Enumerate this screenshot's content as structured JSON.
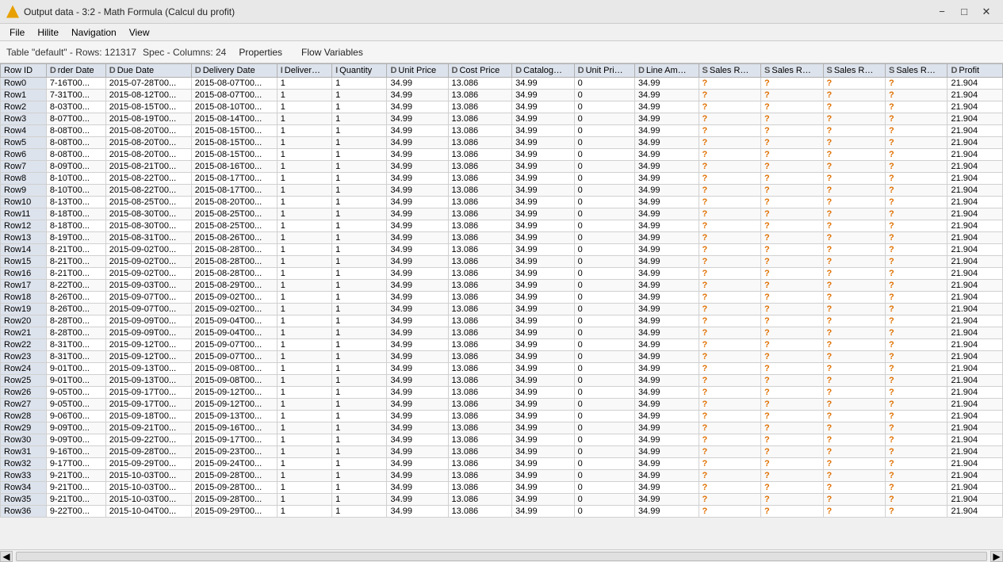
{
  "titleBar": {
    "icon": "triangle-warning",
    "title": "Output data - 3:2 - Math Formula (Calcul du profit)",
    "minimizeLabel": "−",
    "maximizeLabel": "□",
    "closeLabel": "✕"
  },
  "menuBar": {
    "items": [
      "File",
      "Hilite",
      "Navigation",
      "View"
    ]
  },
  "toolbar": {
    "tableInfo": "Table \"default\" - Rows: 121317",
    "specInfo": "Spec - Columns: 24",
    "tabs": [
      {
        "label": "Properties",
        "active": false
      },
      {
        "label": "Flow Variables",
        "active": false
      }
    ]
  },
  "columns": [
    {
      "typeCode": "",
      "label": "Row ID"
    },
    {
      "typeCode": "D",
      "label": "rder Date"
    },
    {
      "typeCode": "D",
      "label": "Due Date"
    },
    {
      "typeCode": "D",
      "label": "Delivery Date"
    },
    {
      "typeCode": "I",
      "label": "Deliver…"
    },
    {
      "typeCode": "I",
      "label": "Quantity"
    },
    {
      "typeCode": "D",
      "label": "Unit Price"
    },
    {
      "typeCode": "D",
      "label": "Cost Price"
    },
    {
      "typeCode": "D",
      "label": "Catalog…"
    },
    {
      "typeCode": "D",
      "label": "Unit Pri…"
    },
    {
      "typeCode": "D",
      "label": "Line Am…"
    },
    {
      "typeCode": "S",
      "label": "Sales R…"
    },
    {
      "typeCode": "S",
      "label": "Sales R…"
    },
    {
      "typeCode": "S",
      "label": "Sales R…"
    },
    {
      "typeCode": "S",
      "label": "Sales R…"
    },
    {
      "typeCode": "D",
      "label": "Profit"
    }
  ],
  "rows": [
    {
      "id": "Row0",
      "orderDate": "7-16T00...",
      "dueDate": "2015-07-28T00...",
      "deliveryDate": "2015-08-07T00...",
      "deliver": "1",
      "quantity": "1",
      "unitPrice": "34.99",
      "costPrice": "13.086",
      "catalog": "34.99",
      "unitPri": "0",
      "lineAm": "34.99",
      "sr1": "?",
      "sr2": "?",
      "sr3": "?",
      "sr4": "?",
      "profit": "21.904"
    },
    {
      "id": "Row1",
      "orderDate": "7-31T00...",
      "dueDate": "2015-08-12T00...",
      "deliveryDate": "2015-08-07T00...",
      "deliver": "1",
      "quantity": "1",
      "unitPrice": "34.99",
      "costPrice": "13.086",
      "catalog": "34.99",
      "unitPri": "0",
      "lineAm": "34.99",
      "sr1": "?",
      "sr2": "?",
      "sr3": "?",
      "sr4": "?",
      "profit": "21.904"
    },
    {
      "id": "Row2",
      "orderDate": "8-03T00...",
      "dueDate": "2015-08-15T00...",
      "deliveryDate": "2015-08-10T00...",
      "deliver": "1",
      "quantity": "1",
      "unitPrice": "34.99",
      "costPrice": "13.086",
      "catalog": "34.99",
      "unitPri": "0",
      "lineAm": "34.99",
      "sr1": "?",
      "sr2": "?",
      "sr3": "?",
      "sr4": "?",
      "profit": "21.904"
    },
    {
      "id": "Row3",
      "orderDate": "8-07T00...",
      "dueDate": "2015-08-19T00...",
      "deliveryDate": "2015-08-14T00...",
      "deliver": "1",
      "quantity": "1",
      "unitPrice": "34.99",
      "costPrice": "13.086",
      "catalog": "34.99",
      "unitPri": "0",
      "lineAm": "34.99",
      "sr1": "?",
      "sr2": "?",
      "sr3": "?",
      "sr4": "?",
      "profit": "21.904"
    },
    {
      "id": "Row4",
      "orderDate": "8-08T00...",
      "dueDate": "2015-08-20T00...",
      "deliveryDate": "2015-08-15T00...",
      "deliver": "1",
      "quantity": "1",
      "unitPrice": "34.99",
      "costPrice": "13.086",
      "catalog": "34.99",
      "unitPri": "0",
      "lineAm": "34.99",
      "sr1": "?",
      "sr2": "?",
      "sr3": "?",
      "sr4": "?",
      "profit": "21.904"
    },
    {
      "id": "Row5",
      "orderDate": "8-08T00...",
      "dueDate": "2015-08-20T00...",
      "deliveryDate": "2015-08-15T00...",
      "deliver": "1",
      "quantity": "1",
      "unitPrice": "34.99",
      "costPrice": "13.086",
      "catalog": "34.99",
      "unitPri": "0",
      "lineAm": "34.99",
      "sr1": "?",
      "sr2": "?",
      "sr3": "?",
      "sr4": "?",
      "profit": "21.904"
    },
    {
      "id": "Row6",
      "orderDate": "8-08T00...",
      "dueDate": "2015-08-20T00...",
      "deliveryDate": "2015-08-15T00...",
      "deliver": "1",
      "quantity": "1",
      "unitPrice": "34.99",
      "costPrice": "13.086",
      "catalog": "34.99",
      "unitPri": "0",
      "lineAm": "34.99",
      "sr1": "?",
      "sr2": "?",
      "sr3": "?",
      "sr4": "?",
      "profit": "21.904"
    },
    {
      "id": "Row7",
      "orderDate": "8-09T00...",
      "dueDate": "2015-08-21T00...",
      "deliveryDate": "2015-08-16T00...",
      "deliver": "1",
      "quantity": "1",
      "unitPrice": "34.99",
      "costPrice": "13.086",
      "catalog": "34.99",
      "unitPri": "0",
      "lineAm": "34.99",
      "sr1": "?",
      "sr2": "?",
      "sr3": "?",
      "sr4": "?",
      "profit": "21.904"
    },
    {
      "id": "Row8",
      "orderDate": "8-10T00...",
      "dueDate": "2015-08-22T00...",
      "deliveryDate": "2015-08-17T00...",
      "deliver": "1",
      "quantity": "1",
      "unitPrice": "34.99",
      "costPrice": "13.086",
      "catalog": "34.99",
      "unitPri": "0",
      "lineAm": "34.99",
      "sr1": "?",
      "sr2": "?",
      "sr3": "?",
      "sr4": "?",
      "profit": "21.904"
    },
    {
      "id": "Row9",
      "orderDate": "8-10T00...",
      "dueDate": "2015-08-22T00...",
      "deliveryDate": "2015-08-17T00...",
      "deliver": "1",
      "quantity": "1",
      "unitPrice": "34.99",
      "costPrice": "13.086",
      "catalog": "34.99",
      "unitPri": "0",
      "lineAm": "34.99",
      "sr1": "?",
      "sr2": "?",
      "sr3": "?",
      "sr4": "?",
      "profit": "21.904"
    },
    {
      "id": "Row10",
      "orderDate": "8-13T00...",
      "dueDate": "2015-08-25T00...",
      "deliveryDate": "2015-08-20T00...",
      "deliver": "1",
      "quantity": "1",
      "unitPrice": "34.99",
      "costPrice": "13.086",
      "catalog": "34.99",
      "unitPri": "0",
      "lineAm": "34.99",
      "sr1": "?",
      "sr2": "?",
      "sr3": "?",
      "sr4": "?",
      "profit": "21.904"
    },
    {
      "id": "Row11",
      "orderDate": "8-18T00...",
      "dueDate": "2015-08-30T00...",
      "deliveryDate": "2015-08-25T00...",
      "deliver": "1",
      "quantity": "1",
      "unitPrice": "34.99",
      "costPrice": "13.086",
      "catalog": "34.99",
      "unitPri": "0",
      "lineAm": "34.99",
      "sr1": "?",
      "sr2": "?",
      "sr3": "?",
      "sr4": "?",
      "profit": "21.904"
    },
    {
      "id": "Row12",
      "orderDate": "8-18T00...",
      "dueDate": "2015-08-30T00...",
      "deliveryDate": "2015-08-25T00...",
      "deliver": "1",
      "quantity": "1",
      "unitPrice": "34.99",
      "costPrice": "13.086",
      "catalog": "34.99",
      "unitPri": "0",
      "lineAm": "34.99",
      "sr1": "?",
      "sr2": "?",
      "sr3": "?",
      "sr4": "?",
      "profit": "21.904"
    },
    {
      "id": "Row13",
      "orderDate": "8-19T00...",
      "dueDate": "2015-08-31T00...",
      "deliveryDate": "2015-08-26T00...",
      "deliver": "1",
      "quantity": "1",
      "unitPrice": "34.99",
      "costPrice": "13.086",
      "catalog": "34.99",
      "unitPri": "0",
      "lineAm": "34.99",
      "sr1": "?",
      "sr2": "?",
      "sr3": "?",
      "sr4": "?",
      "profit": "21.904"
    },
    {
      "id": "Row14",
      "orderDate": "8-21T00...",
      "dueDate": "2015-09-02T00...",
      "deliveryDate": "2015-08-28T00...",
      "deliver": "1",
      "quantity": "1",
      "unitPrice": "34.99",
      "costPrice": "13.086",
      "catalog": "34.99",
      "unitPri": "0",
      "lineAm": "34.99",
      "sr1": "?",
      "sr2": "?",
      "sr3": "?",
      "sr4": "?",
      "profit": "21.904"
    },
    {
      "id": "Row15",
      "orderDate": "8-21T00...",
      "dueDate": "2015-09-02T00...",
      "deliveryDate": "2015-08-28T00...",
      "deliver": "1",
      "quantity": "1",
      "unitPrice": "34.99",
      "costPrice": "13.086",
      "catalog": "34.99",
      "unitPri": "0",
      "lineAm": "34.99",
      "sr1": "?",
      "sr2": "?",
      "sr3": "?",
      "sr4": "?",
      "profit": "21.904"
    },
    {
      "id": "Row16",
      "orderDate": "8-21T00...",
      "dueDate": "2015-09-02T00...",
      "deliveryDate": "2015-08-28T00...",
      "deliver": "1",
      "quantity": "1",
      "unitPrice": "34.99",
      "costPrice": "13.086",
      "catalog": "34.99",
      "unitPri": "0",
      "lineAm": "34.99",
      "sr1": "?",
      "sr2": "?",
      "sr3": "?",
      "sr4": "?",
      "profit": "21.904"
    },
    {
      "id": "Row17",
      "orderDate": "8-22T00...",
      "dueDate": "2015-09-03T00...",
      "deliveryDate": "2015-08-29T00...",
      "deliver": "1",
      "quantity": "1",
      "unitPrice": "34.99",
      "costPrice": "13.086",
      "catalog": "34.99",
      "unitPri": "0",
      "lineAm": "34.99",
      "sr1": "?",
      "sr2": "?",
      "sr3": "?",
      "sr4": "?",
      "profit": "21.904"
    },
    {
      "id": "Row18",
      "orderDate": "8-26T00...",
      "dueDate": "2015-09-07T00...",
      "deliveryDate": "2015-09-02T00...",
      "deliver": "1",
      "quantity": "1",
      "unitPrice": "34.99",
      "costPrice": "13.086",
      "catalog": "34.99",
      "unitPri": "0",
      "lineAm": "34.99",
      "sr1": "?",
      "sr2": "?",
      "sr3": "?",
      "sr4": "?",
      "profit": "21.904"
    },
    {
      "id": "Row19",
      "orderDate": "8-26T00...",
      "dueDate": "2015-09-07T00...",
      "deliveryDate": "2015-09-02T00...",
      "deliver": "1",
      "quantity": "1",
      "unitPrice": "34.99",
      "costPrice": "13.086",
      "catalog": "34.99",
      "unitPri": "0",
      "lineAm": "34.99",
      "sr1": "?",
      "sr2": "?",
      "sr3": "?",
      "sr4": "?",
      "profit": "21.904"
    },
    {
      "id": "Row20",
      "orderDate": "8-28T00...",
      "dueDate": "2015-09-09T00...",
      "deliveryDate": "2015-09-04T00...",
      "deliver": "1",
      "quantity": "1",
      "unitPrice": "34.99",
      "costPrice": "13.086",
      "catalog": "34.99",
      "unitPri": "0",
      "lineAm": "34.99",
      "sr1": "?",
      "sr2": "?",
      "sr3": "?",
      "sr4": "?",
      "profit": "21.904"
    },
    {
      "id": "Row21",
      "orderDate": "8-28T00...",
      "dueDate": "2015-09-09T00...",
      "deliveryDate": "2015-09-04T00...",
      "deliver": "1",
      "quantity": "1",
      "unitPrice": "34.99",
      "costPrice": "13.086",
      "catalog": "34.99",
      "unitPri": "0",
      "lineAm": "34.99",
      "sr1": "?",
      "sr2": "?",
      "sr3": "?",
      "sr4": "?",
      "profit": "21.904"
    },
    {
      "id": "Row22",
      "orderDate": "8-31T00...",
      "dueDate": "2015-09-12T00...",
      "deliveryDate": "2015-09-07T00...",
      "deliver": "1",
      "quantity": "1",
      "unitPrice": "34.99",
      "costPrice": "13.086",
      "catalog": "34.99",
      "unitPri": "0",
      "lineAm": "34.99",
      "sr1": "?",
      "sr2": "?",
      "sr3": "?",
      "sr4": "?",
      "profit": "21.904"
    },
    {
      "id": "Row23",
      "orderDate": "8-31T00...",
      "dueDate": "2015-09-12T00...",
      "deliveryDate": "2015-09-07T00...",
      "deliver": "1",
      "quantity": "1",
      "unitPrice": "34.99",
      "costPrice": "13.086",
      "catalog": "34.99",
      "unitPri": "0",
      "lineAm": "34.99",
      "sr1": "?",
      "sr2": "?",
      "sr3": "?",
      "sr4": "?",
      "profit": "21.904"
    },
    {
      "id": "Row24",
      "orderDate": "9-01T00...",
      "dueDate": "2015-09-13T00...",
      "deliveryDate": "2015-09-08T00...",
      "deliver": "1",
      "quantity": "1",
      "unitPrice": "34.99",
      "costPrice": "13.086",
      "catalog": "34.99",
      "unitPri": "0",
      "lineAm": "34.99",
      "sr1": "?",
      "sr2": "?",
      "sr3": "?",
      "sr4": "?",
      "profit": "21.904"
    },
    {
      "id": "Row25",
      "orderDate": "9-01T00...",
      "dueDate": "2015-09-13T00...",
      "deliveryDate": "2015-09-08T00...",
      "deliver": "1",
      "quantity": "1",
      "unitPrice": "34.99",
      "costPrice": "13.086",
      "catalog": "34.99",
      "unitPri": "0",
      "lineAm": "34.99",
      "sr1": "?",
      "sr2": "?",
      "sr3": "?",
      "sr4": "?",
      "profit": "21.904"
    },
    {
      "id": "Row26",
      "orderDate": "9-05T00...",
      "dueDate": "2015-09-17T00...",
      "deliveryDate": "2015-09-12T00...",
      "deliver": "1",
      "quantity": "1",
      "unitPrice": "34.99",
      "costPrice": "13.086",
      "catalog": "34.99",
      "unitPri": "0",
      "lineAm": "34.99",
      "sr1": "?",
      "sr2": "?",
      "sr3": "?",
      "sr4": "?",
      "profit": "21.904"
    },
    {
      "id": "Row27",
      "orderDate": "9-05T00...",
      "dueDate": "2015-09-17T00...",
      "deliveryDate": "2015-09-12T00...",
      "deliver": "1",
      "quantity": "1",
      "unitPrice": "34.99",
      "costPrice": "13.086",
      "catalog": "34.99",
      "unitPri": "0",
      "lineAm": "34.99",
      "sr1": "?",
      "sr2": "?",
      "sr3": "?",
      "sr4": "?",
      "profit": "21.904"
    },
    {
      "id": "Row28",
      "orderDate": "9-06T00...",
      "dueDate": "2015-09-18T00...",
      "deliveryDate": "2015-09-13T00...",
      "deliver": "1",
      "quantity": "1",
      "unitPrice": "34.99",
      "costPrice": "13.086",
      "catalog": "34.99",
      "unitPri": "0",
      "lineAm": "34.99",
      "sr1": "?",
      "sr2": "?",
      "sr3": "?",
      "sr4": "?",
      "profit": "21.904"
    },
    {
      "id": "Row29",
      "orderDate": "9-09T00...",
      "dueDate": "2015-09-21T00...",
      "deliveryDate": "2015-09-16T00...",
      "deliver": "1",
      "quantity": "1",
      "unitPrice": "34.99",
      "costPrice": "13.086",
      "catalog": "34.99",
      "unitPri": "0",
      "lineAm": "34.99",
      "sr1": "?",
      "sr2": "?",
      "sr3": "?",
      "sr4": "?",
      "profit": "21.904"
    },
    {
      "id": "Row30",
      "orderDate": "9-09T00...",
      "dueDate": "2015-09-22T00...",
      "deliveryDate": "2015-09-17T00...",
      "deliver": "1",
      "quantity": "1",
      "unitPrice": "34.99",
      "costPrice": "13.086",
      "catalog": "34.99",
      "unitPri": "0",
      "lineAm": "34.99",
      "sr1": "?",
      "sr2": "?",
      "sr3": "?",
      "sr4": "?",
      "profit": "21.904"
    },
    {
      "id": "Row31",
      "orderDate": "9-16T00...",
      "dueDate": "2015-09-28T00...",
      "deliveryDate": "2015-09-23T00...",
      "deliver": "1",
      "quantity": "1",
      "unitPrice": "34.99",
      "costPrice": "13.086",
      "catalog": "34.99",
      "unitPri": "0",
      "lineAm": "34.99",
      "sr1": "?",
      "sr2": "?",
      "sr3": "?",
      "sr4": "?",
      "profit": "21.904"
    },
    {
      "id": "Row32",
      "orderDate": "9-17T00...",
      "dueDate": "2015-09-29T00...",
      "deliveryDate": "2015-09-24T00...",
      "deliver": "1",
      "quantity": "1",
      "unitPrice": "34.99",
      "costPrice": "13.086",
      "catalog": "34.99",
      "unitPri": "0",
      "lineAm": "34.99",
      "sr1": "?",
      "sr2": "?",
      "sr3": "?",
      "sr4": "?",
      "profit": "21.904"
    },
    {
      "id": "Row33",
      "orderDate": "9-21T00...",
      "dueDate": "2015-10-03T00...",
      "deliveryDate": "2015-09-28T00...",
      "deliver": "1",
      "quantity": "1",
      "unitPrice": "34.99",
      "costPrice": "13.086",
      "catalog": "34.99",
      "unitPri": "0",
      "lineAm": "34.99",
      "sr1": "?",
      "sr2": "?",
      "sr3": "?",
      "sr4": "?",
      "profit": "21.904"
    },
    {
      "id": "Row34",
      "orderDate": "9-21T00...",
      "dueDate": "2015-10-03T00...",
      "deliveryDate": "2015-09-28T00...",
      "deliver": "1",
      "quantity": "1",
      "unitPrice": "34.99",
      "costPrice": "13.086",
      "catalog": "34.99",
      "unitPri": "0",
      "lineAm": "34.99",
      "sr1": "?",
      "sr2": "?",
      "sr3": "?",
      "sr4": "?",
      "profit": "21.904"
    },
    {
      "id": "Row35",
      "orderDate": "9-21T00...",
      "dueDate": "2015-10-03T00...",
      "deliveryDate": "2015-09-28T00...",
      "deliver": "1",
      "quantity": "1",
      "unitPrice": "34.99",
      "costPrice": "13.086",
      "catalog": "34.99",
      "unitPri": "0",
      "lineAm": "34.99",
      "sr1": "?",
      "sr2": "?",
      "sr3": "?",
      "sr4": "?",
      "profit": "21.904"
    },
    {
      "id": "Row36",
      "orderDate": "9-22T00...",
      "dueDate": "2015-10-04T00...",
      "deliveryDate": "2015-09-29T00...",
      "deliver": "1",
      "quantity": "1",
      "unitPrice": "34.99",
      "costPrice": "13.086",
      "catalog": "34.99",
      "unitPri": "0",
      "lineAm": "34.99",
      "sr1": "?",
      "sr2": "?",
      "sr3": "?",
      "sr4": "?",
      "profit": "21.904"
    }
  ]
}
